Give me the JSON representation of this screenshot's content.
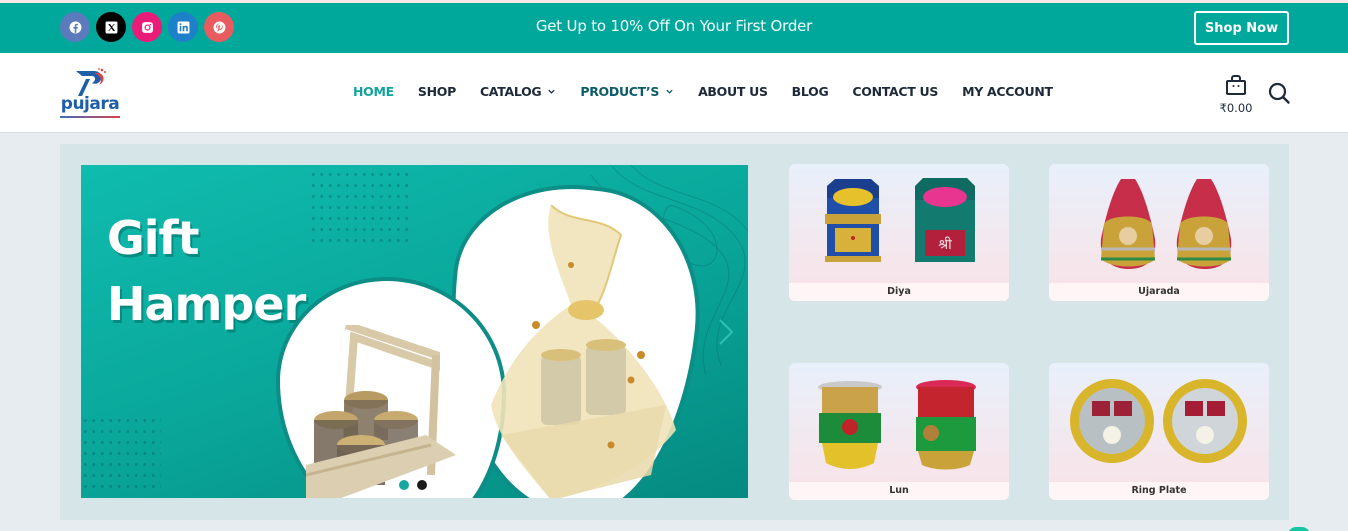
{
  "topbar": {
    "socials": [
      {
        "name": "facebook",
        "icon": "facebook-icon",
        "color": "#5b7bbd"
      },
      {
        "name": "x",
        "icon": "x-twitter-icon",
        "color": "#000000"
      },
      {
        "name": "instagram",
        "icon": "instagram-icon",
        "color": "#ea1c7a"
      },
      {
        "name": "linkedin",
        "icon": "linkedin-icon",
        "color": "#1d80c9"
      },
      {
        "name": "pinterest",
        "icon": "pinterest-icon",
        "color": "#e85b5e"
      }
    ],
    "promo_text": "Get Up to 10% Off  On Your First Order",
    "shop_now_label": "Shop Now",
    "background": "#00a89c"
  },
  "header": {
    "logo_text": "pujara",
    "nav": [
      {
        "label": "HOME",
        "active": true
      },
      {
        "label": "SHOP"
      },
      {
        "label": "CATALOG",
        "dropdown": true
      },
      {
        "label": "PRODUCT’S",
        "dropdown": true
      },
      {
        "label": "ABOUT US"
      },
      {
        "label": "BLOG"
      },
      {
        "label": "CONTACT US"
      },
      {
        "label": "MY ACCOUNT"
      }
    ],
    "cart_total": "₹0.00",
    "cart_icon": "shopping-bag-icon",
    "search_icon": "search-icon"
  },
  "hero": {
    "title_line1": "Gift",
    "title_line2": "Hamper",
    "slides_count": 2,
    "active_slide": 1,
    "dot_colors": {
      "active": "#16a7a0",
      "inactive": "#1b1b1b"
    }
  },
  "categories": [
    {
      "label": "Diya"
    },
    {
      "label": "Ujarada"
    },
    {
      "label": "Lun"
    },
    {
      "label": "Ring Plate"
    }
  ]
}
